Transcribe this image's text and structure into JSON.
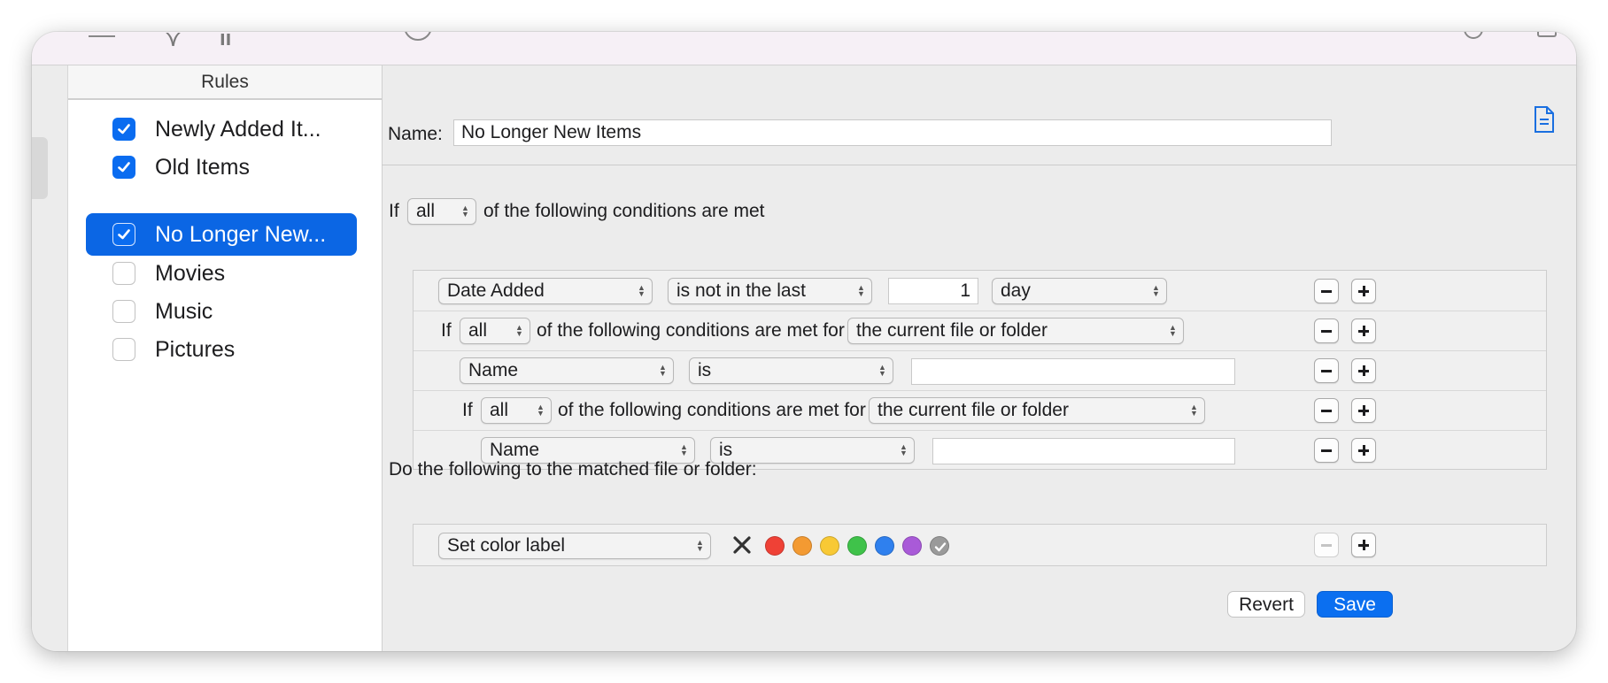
{
  "sidebar": {
    "header": "Rules",
    "rules": [
      {
        "label": "Newly Added It...",
        "checked": true,
        "selected": false
      },
      {
        "label": "Old Items",
        "checked": true,
        "selected": false
      },
      {
        "label": "No Longer New...",
        "checked": true,
        "selected": true
      },
      {
        "label": "Movies",
        "checked": false,
        "selected": false
      },
      {
        "label": "Music",
        "checked": false,
        "selected": false
      },
      {
        "label": "Pictures",
        "checked": false,
        "selected": false
      }
    ]
  },
  "editor": {
    "name_label": "Name:",
    "name_value": "No Longer New Items",
    "top_condition": {
      "prefix": "If",
      "match": "all",
      "suffix": "of the following conditions are met"
    },
    "rows": [
      {
        "attribute": "Date Added",
        "operator": "is not in the last",
        "value": "1",
        "unit": "day"
      },
      {
        "prefix": "If",
        "match": "all",
        "suffix": "of the following conditions are met for",
        "target": "the current file or folder"
      },
      {
        "attribute": "Name",
        "operator": "is",
        "value": ""
      },
      {
        "prefix": "If",
        "match": "all",
        "suffix": "of the following conditions are met for",
        "target": "the current file or folder"
      },
      {
        "attribute": "Name",
        "operator": "is",
        "value": ""
      }
    ],
    "action_heading": "Do the following to the matched file or folder:",
    "action": {
      "type": "Set color label",
      "colors": [
        "#ef4136",
        "#f39a32",
        "#f8c935",
        "#3fc24a",
        "#2f80ee",
        "#a95ad8",
        "#9a9a9a"
      ]
    },
    "revert_label": "Revert",
    "save_label": "Save"
  },
  "colors": {
    "accent": "#0b66e4",
    "save": "#0b6ff0"
  }
}
